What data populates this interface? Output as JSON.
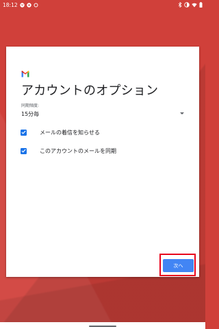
{
  "status_bar": {
    "time": "18:12",
    "left_icons": [
      "gmail-notification-icon",
      "notification-dot-icon",
      "sync-icon"
    ],
    "right_icons": [
      "bluetooth-icon",
      "eye-comfort-icon",
      "wifi-icon",
      "battery-icon"
    ]
  },
  "card": {
    "logo": "gmail-logo",
    "title": "アカウントのオプション",
    "sync_frequency": {
      "label": "同期頻度:",
      "value": "15分毎"
    },
    "options": [
      {
        "label": "メールの着信を知らせる",
        "checked": true
      },
      {
        "label": "このアカウントのメールを同期",
        "checked": true
      }
    ],
    "next_button_label": "次へ"
  },
  "colors": {
    "background": "#d0403a",
    "accent": "#4285f4",
    "checkbox": "#1a73e8",
    "highlight": "#e8001c"
  }
}
